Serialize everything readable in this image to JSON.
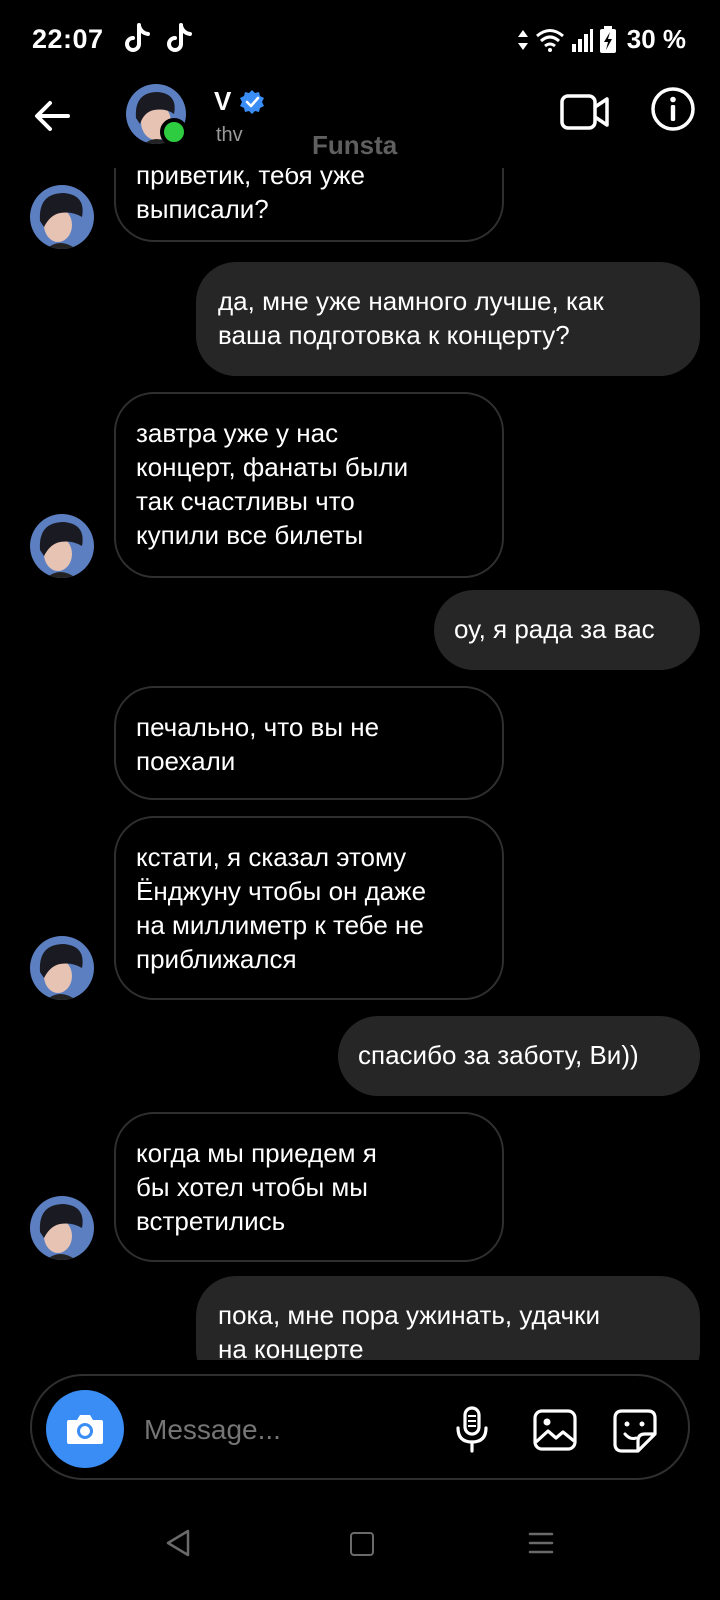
{
  "status_bar": {
    "time": "22:07",
    "battery": "30 %",
    "icons": [
      "tiktok-icon",
      "tiktok-icon",
      "data-arrows-icon",
      "wifi-icon",
      "signal-icon",
      "battery-charging-icon"
    ]
  },
  "header": {
    "name": "V",
    "username": "thv",
    "watermark": "Funsta",
    "verified": true,
    "online": true,
    "icons": [
      "back-arrow-icon",
      "video-call-icon",
      "info-icon",
      "verified-badge-icon"
    ]
  },
  "messages": [
    {
      "direction": "in",
      "lines": [
        "приветик, тебя уже",
        "выписали?"
      ],
      "show_avatar": true
    },
    {
      "direction": "out",
      "lines": [
        "да, мне уже намного лучше, как",
        "ваша подготовка к концерту?"
      ]
    },
    {
      "direction": "in",
      "lines": [
        "завтра уже у нас",
        "концерт, фанаты были",
        "так счастливы что",
        "купили все билеты"
      ],
      "show_avatar": true
    },
    {
      "direction": "out",
      "lines": [
        "оу, я рада за вас"
      ]
    },
    {
      "direction": "in",
      "lines": [
        "печально, что вы не",
        "поехали"
      ],
      "show_avatar": false
    },
    {
      "direction": "in",
      "lines": [
        "кстати, я сказал этому",
        "Ёнджуну чтобы он даже",
        "на миллиметр к тебе не",
        "приближался"
      ],
      "show_avatar": true
    },
    {
      "direction": "out",
      "lines": [
        "спасибо за заботу, Ви))"
      ]
    },
    {
      "direction": "in",
      "lines": [
        "когда мы приедем я",
        "бы хотел чтобы мы",
        "встретились"
      ],
      "show_avatar": true
    },
    {
      "direction": "out",
      "lines": [
        "пока, мне пора ужинать, удачки",
        "на концерте"
      ]
    }
  ],
  "composer": {
    "placeholder": "Message...",
    "icons": [
      "camera-icon",
      "microphone-icon",
      "gallery-icon",
      "sticker-icon"
    ]
  },
  "navbar": {
    "icons": [
      "nav-back-icon",
      "nav-home-icon",
      "nav-recents-icon"
    ]
  },
  "colors": {
    "background": "#000000",
    "incoming_border": "#2f2f2f",
    "outgoing_bubble": "#262626",
    "accent_blue": "#3a8df5",
    "online_green": "#2ecc40"
  }
}
